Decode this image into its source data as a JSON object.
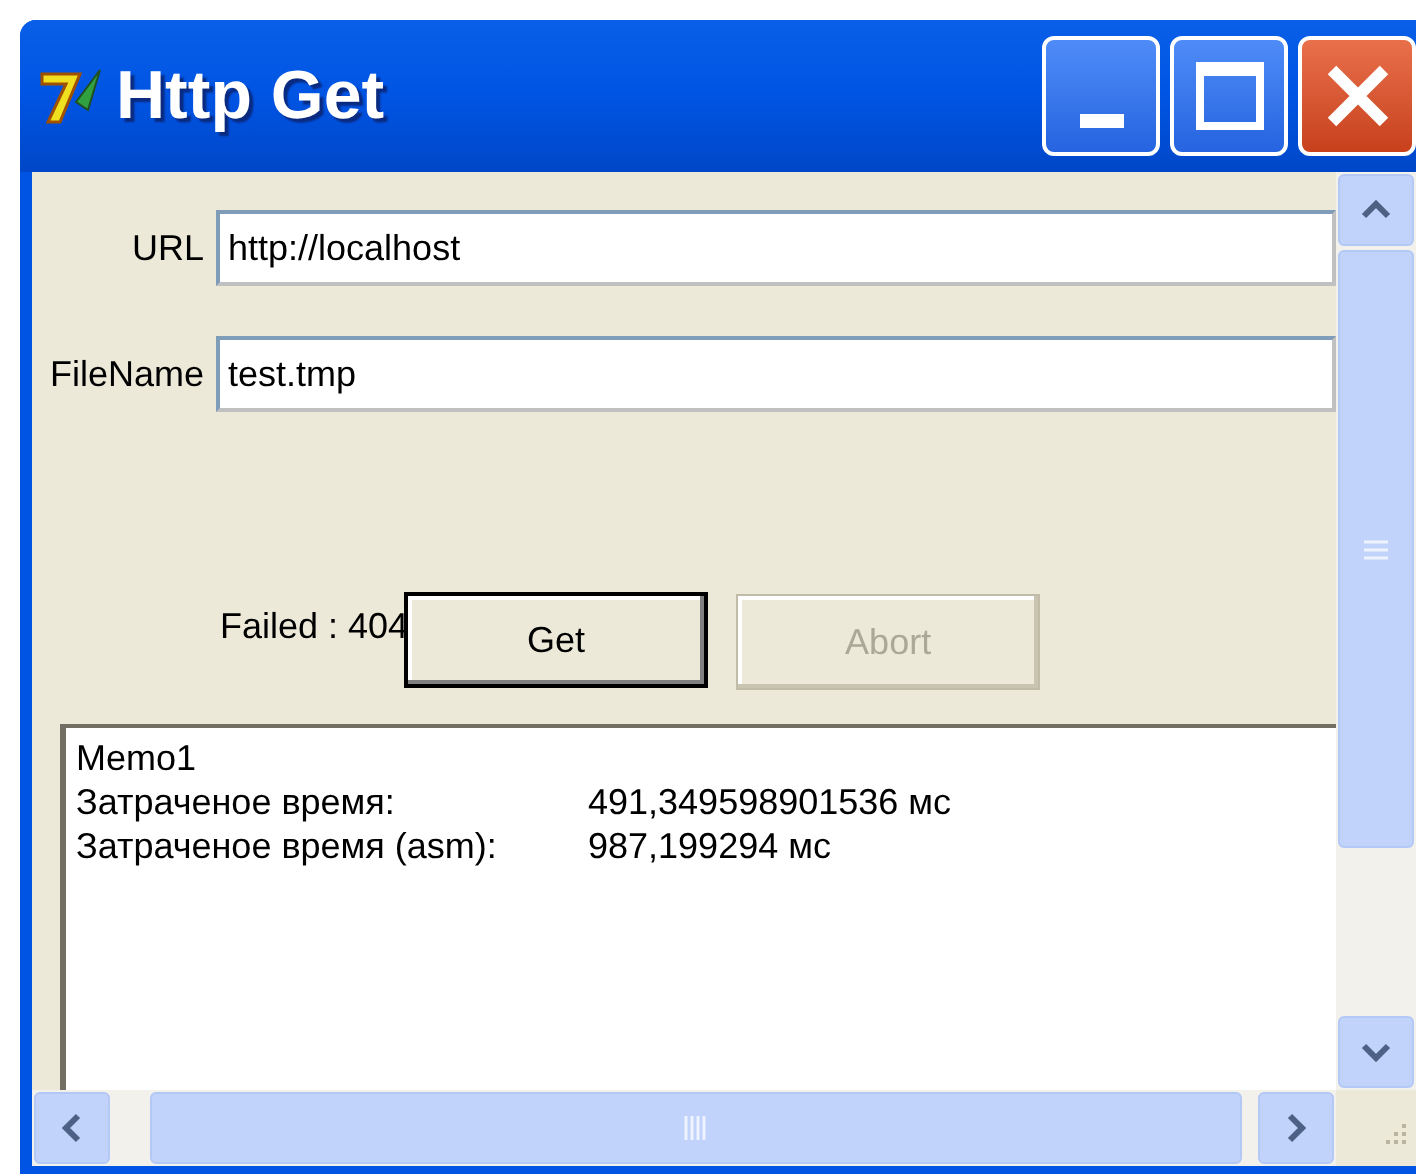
{
  "window": {
    "title": "Http Get"
  },
  "fields": [
    {
      "label": "URL",
      "value": "http://localhost"
    },
    {
      "label": "FileName",
      "value": "test.tmp"
    }
  ],
  "status": "Failed : 404",
  "buttons": [
    {
      "label": "Get",
      "disabled": false,
      "default": true
    },
    {
      "label": "Abort",
      "disabled": true,
      "default": false
    }
  ],
  "memo": {
    "lines": [
      {
        "label": "Memo1"
      },
      {
        "label": "Затраченое время:",
        "value": "491,349598901536 мс"
      },
      {
        "label": "Затраченое время (asm):",
        "value": "987,199294 мс"
      }
    ]
  }
}
